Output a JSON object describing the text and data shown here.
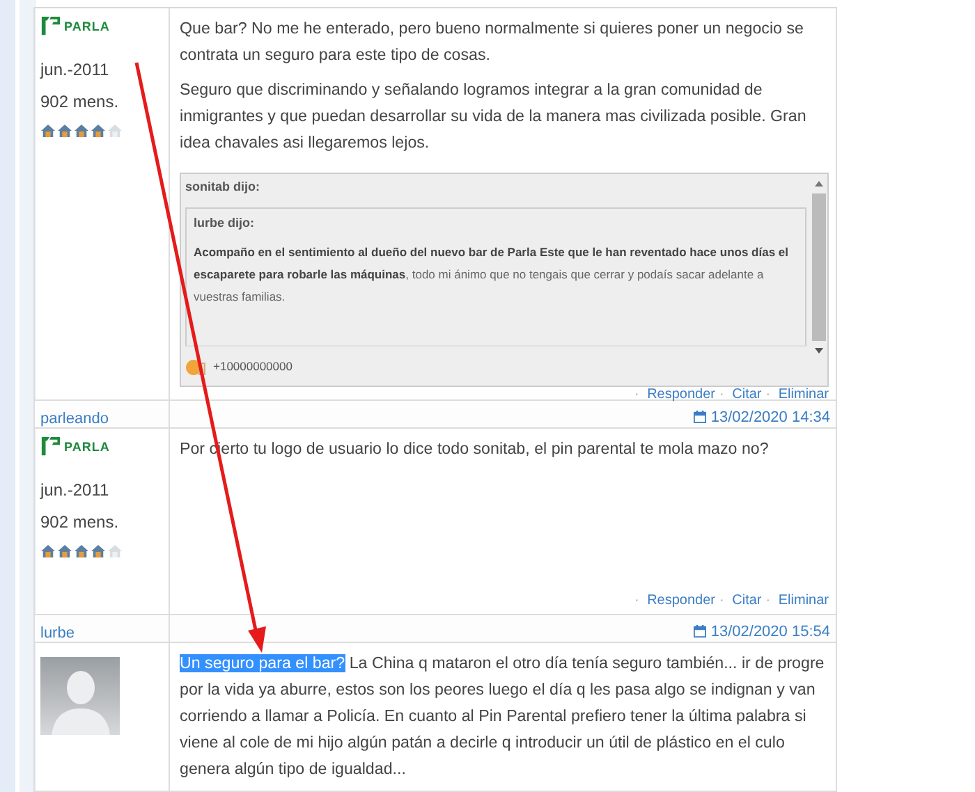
{
  "posts": [
    {
      "logo_text": "PARLA",
      "joined": "jun.-2011",
      "messages": "902 mens.",
      "stars": 4,
      "kind": "logo",
      "paragraphs": [
        "Que bar? No me he enterado, pero bueno normalmente si quieres poner un negocio se contrata un seguro para este tipo de cosas.",
        "Seguro que discriminando y señalando logramos integrar a la gran comunidad de inmigrantes y que puedan desarrollar su vida de la manera mas civilizada posible. Gran idea chavales asi llegaremos lejos."
      ],
      "quote": {
        "author": "sonitab dijo:",
        "inner_author": "lurbe dijo:",
        "inner_text": "**Acompaño en el sentimiento al dueño del nuevo bar de Parla Este que le han reventado hace unos días el escaparete para robarle las máquinas**, todo mi ánimo que no tengais que cerrar y podaís sacar adelante a vuestras familias.",
        "reaction": "+10000000000"
      },
      "separator": "·",
      "links": [
        "Responder",
        "Citar",
        "Eliminar"
      ]
    },
    {
      "username": "parleando",
      "date": "13/02/2020 14:34",
      "logo_text": "PARLA",
      "joined": "jun.-2011",
      "messages": "902 mens.",
      "stars": 4,
      "kind": "logo",
      "paragraphs": [
        "Por cierto tu logo de usuario lo dice todo sonitab, el pin parental te mola mazo no?"
      ],
      "separator": "·",
      "links": [
        "Responder",
        "Citar",
        "Eliminar"
      ]
    },
    {
      "username": "lurbe",
      "date": "13/02/2020 15:54",
      "kind": "silhouette",
      "selected_text": "Un seguro para el bar?",
      "paragraphs": [
        "La China q mataron el otro día tenía seguro también... ir de progre por la vida ya aburre, estos son los peores luego el día q les pasa algo se indignan y van corriendo a llamar a Policía. En cuanto al Pin Parental prefiero tener la última palabra si viene al cole de mi hijo algún patán a decirle q introducir un útil de plástico en el culo genera algún tipo de igualdad..."
      ]
    }
  ]
}
